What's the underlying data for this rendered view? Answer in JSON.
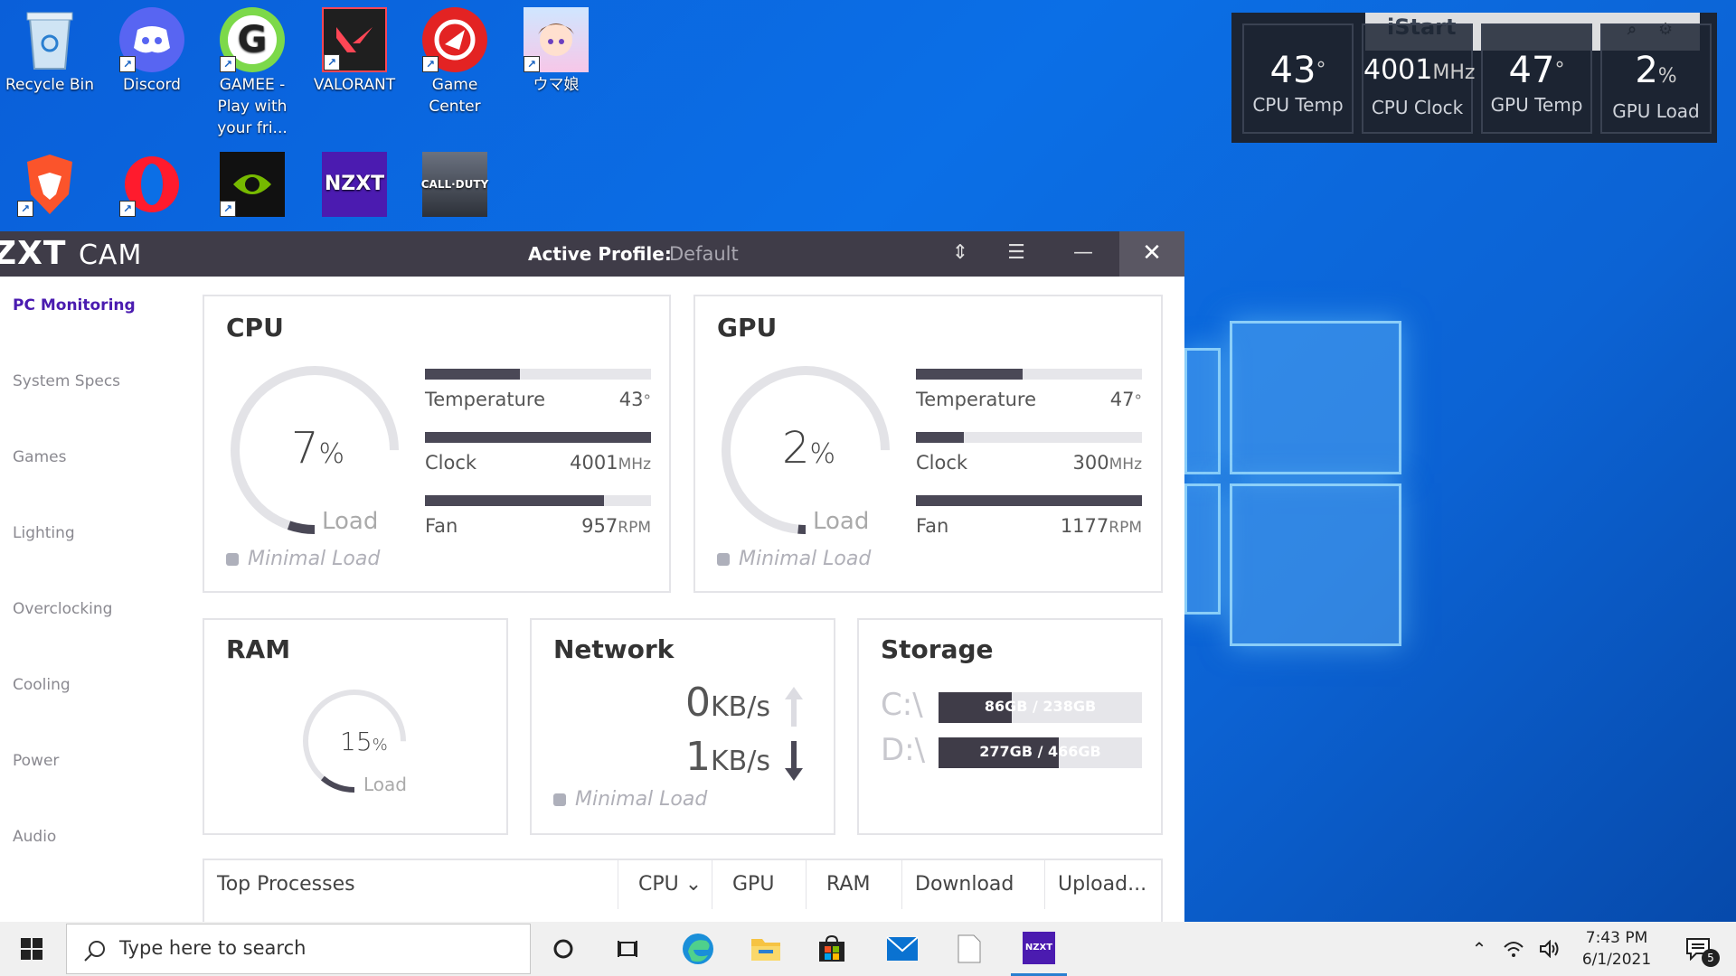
{
  "desktop": {
    "icons_row1": [
      "Recycle Bin",
      "Discord",
      "GAMEE - Play with your fri...",
      "VALORANT",
      "Game Center",
      "ウマ娘"
    ],
    "icons_row2_glyphs": [
      "🦁",
      "O",
      "▶",
      "NZXT",
      "CALL·DUTY"
    ]
  },
  "istart": {
    "title": "iStart",
    "cells": [
      {
        "value": "43",
        "unit": "°",
        "label": "CPU Temp"
      },
      {
        "value": "4001",
        "unit": "MHz",
        "label": "CPU Clock"
      },
      {
        "value": "47",
        "unit": "°",
        "label": "GPU Temp"
      },
      {
        "value": "2",
        "unit": "%",
        "label": "GPU Load"
      }
    ]
  },
  "cam": {
    "logo_bold": "ZXT",
    "logo_light": "CAM",
    "profile_label": "Active Profile:",
    "profile_value": "Default",
    "sidebar": [
      "PC Monitoring",
      "System Specs",
      "Games",
      "Lighting",
      "Overclocking",
      "Cooling",
      "Power",
      "Audio"
    ],
    "cpu": {
      "title": "CPU",
      "load": "7",
      "load_unit": "%",
      "load_label": "Load",
      "status": "Minimal Load",
      "load_fraction": 0.07,
      "metrics": [
        {
          "label": "Temperature",
          "value": "43",
          "unit": "°",
          "fill": 0.42
        },
        {
          "label": "Clock",
          "value": "4001",
          "unit": "MHz",
          "fill": 1.0
        },
        {
          "label": "Fan",
          "value": "957",
          "unit": "RPM",
          "fill": 0.79
        }
      ]
    },
    "gpu": {
      "title": "GPU",
      "load": "2",
      "load_unit": "%",
      "load_label": "Load",
      "status": "Minimal Load",
      "load_fraction": 0.02,
      "metrics": [
        {
          "label": "Temperature",
          "value": "47",
          "unit": "°",
          "fill": 0.47
        },
        {
          "label": "Clock",
          "value": "300",
          "unit": "MHz",
          "fill": 0.21
        },
        {
          "label": "Fan",
          "value": "1177",
          "unit": "RPM",
          "fill": 1.0
        }
      ]
    },
    "ram": {
      "title": "RAM",
      "load": "15",
      "load_unit": "%",
      "load_label": "Load",
      "load_fraction": 0.15
    },
    "network": {
      "title": "Network",
      "up": "0",
      "down": "1",
      "unit": "KB/s",
      "status": "Minimal Load"
    },
    "storage": {
      "title": "Storage",
      "drives": [
        {
          "letter": "C:\\",
          "text": "86GB / 238GB",
          "fill": 0.36
        },
        {
          "letter": "D:\\",
          "text": "277GB / 466GB",
          "fill": 0.59
        }
      ]
    },
    "processes": {
      "headers": [
        "Top Processes",
        "CPU",
        "GPU",
        "RAM",
        "Download",
        "Upload..."
      ]
    }
  },
  "taskbar": {
    "search_placeholder": "Type here to search",
    "time": "7:43 PM",
    "date": "6/1/2021",
    "notif_count": "5",
    "nzxt_label": "NZXT"
  }
}
